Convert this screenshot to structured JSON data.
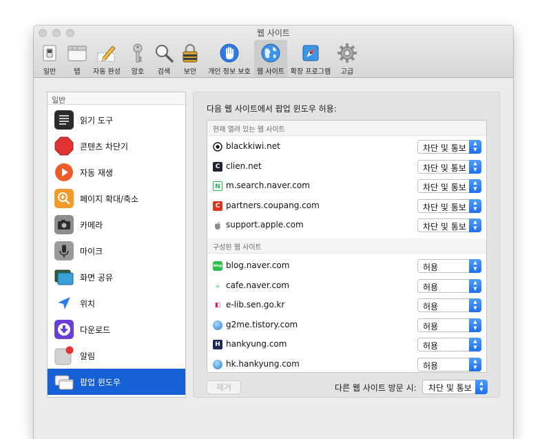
{
  "window": {
    "title": "웹 사이트"
  },
  "toolbar": {
    "items": [
      {
        "label": "일반",
        "icon": "general-switch-icon"
      },
      {
        "label": "탭",
        "icon": "tabs-icon"
      },
      {
        "label": "자동 완성",
        "icon": "autofill-pencil-icon"
      },
      {
        "label": "암호",
        "icon": "key-icon"
      },
      {
        "label": "검색",
        "icon": "magnifier-icon"
      },
      {
        "label": "보안",
        "icon": "padlock-icon"
      },
      {
        "label": "개인 정보 보호",
        "icon": "privacy-hand-icon"
      },
      {
        "label": "웹 사이트",
        "icon": "globe-icon",
        "selected": true
      },
      {
        "label": "확장 프로그램",
        "icon": "puzzle-compass-icon"
      },
      {
        "label": "고급",
        "icon": "gear-icon"
      }
    ]
  },
  "sidebar": {
    "header": "일반",
    "items": [
      {
        "label": "읽기 도구",
        "icon": "reader-icon"
      },
      {
        "label": "콘텐츠 차단기",
        "icon": "stop-sign-icon"
      },
      {
        "label": "자동 재생",
        "icon": "play-icon"
      },
      {
        "label": "페이지 확대/축소",
        "icon": "zoom-icon"
      },
      {
        "label": "카메라",
        "icon": "camera-icon"
      },
      {
        "label": "마이크",
        "icon": "microphone-icon"
      },
      {
        "label": "화면 공유",
        "icon": "screen-share-icon"
      },
      {
        "label": "위치",
        "icon": "location-arrow-icon"
      },
      {
        "label": "다운로드",
        "icon": "download-icon"
      },
      {
        "label": "알림",
        "icon": "notification-icon"
      },
      {
        "label": "팝업 윈도우",
        "icon": "popup-window-icon",
        "selected": true
      }
    ]
  },
  "panel": {
    "heading": "다음 웹 사이트에서 팝업 윈도우 허용:",
    "open_section": "현재 열려 있는 웹 사이트",
    "open_sites": [
      {
        "site": "blackkiwi.net",
        "value": "차단 및 통보",
        "favicon": "bk-favicon",
        "fav_text": "◉",
        "fav_bg": "#ffffff",
        "fav_color": "#111111"
      },
      {
        "site": "clien.net",
        "value": "차단 및 통보",
        "favicon": "clien-favicon",
        "fav_text": "C",
        "fav_bg": "#1e2433",
        "fav_color": "#ffffff"
      },
      {
        "site": "m.search.naver.com",
        "value": "차단 및 통보",
        "favicon": "naver-favicon",
        "fav_text": "N",
        "fav_bg": "#ffffff",
        "fav_color": "#1fb447"
      },
      {
        "site": "partners.coupang.com",
        "value": "차단 및 통보",
        "favicon": "coupang-favicon",
        "fav_text": "C",
        "fav_bg": "#e33224",
        "fav_color": "#ffffff"
      },
      {
        "site": "support.apple.com",
        "value": "차단 및 통보",
        "favicon": "apple-favicon",
        "fav_text": "",
        "fav_bg": "#ffffff",
        "fav_color": "#777777"
      }
    ],
    "configured_section": "구성된 웹 사이트",
    "configured_sites": [
      {
        "site": "blog.naver.com",
        "value": "허용",
        "favicon": "naver-blog-favicon",
        "fav_text": "blog",
        "fav_bg": "#2dbf4b",
        "fav_color": "#ffffff"
      },
      {
        "site": "cafe.naver.com",
        "value": "허용",
        "favicon": "naver-cafe-favicon",
        "fav_text": "☕",
        "fav_bg": "#ffffff",
        "fav_color": "#2dbf4b"
      },
      {
        "site": "e-lib.sen.go.kr",
        "value": "허용",
        "favicon": "elib-favicon",
        "fav_text": "◧",
        "fav_bg": "#ffffff",
        "fav_color": "#d6246e"
      },
      {
        "site": "g2me.tistory.com",
        "value": "허용",
        "favicon": "globe-favicon",
        "fav_text": "",
        "fav_bg": "#3b8fde",
        "fav_color": "#ffffff"
      },
      {
        "site": "hankyung.com",
        "value": "허용",
        "favicon": "hankyung-favicon",
        "fav_text": "H",
        "fav_bg": "#1b2a55",
        "fav_color": "#ffffff"
      },
      {
        "site": "hk.hankyung.com",
        "value": "허용",
        "favicon": "globe-favicon",
        "fav_text": "",
        "fav_bg": "#3b8fde",
        "fav_color": "#ffffff"
      }
    ],
    "remove_label": "제거",
    "other_label": "다른 웹 사이트 방문 시:",
    "other_value": "차단 및 통보"
  },
  "colors": {
    "accent": "#1660d6",
    "popup_arrow": "#1d6ff2"
  }
}
